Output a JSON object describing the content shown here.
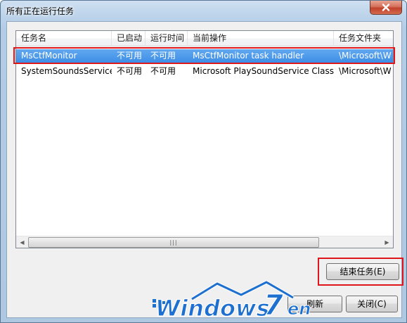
{
  "window": {
    "title": "所有正在运行任务",
    "close_icon": "close-icon"
  },
  "list": {
    "columns": [
      "任务名",
      "已启动",
      "运行时间",
      "当前操作",
      "任务文件夹"
    ],
    "rows": [
      {
        "name": "MsCtfMonitor",
        "started": "不可用",
        "runtime": "不可用",
        "action": "MsCtfMonitor task handler",
        "folder": "\\Microsoft\\W",
        "selected": true
      },
      {
        "name": "SystemSoundsService",
        "started": "不可用",
        "runtime": "不可用",
        "action": "Microsoft PlaySoundService Class",
        "folder": "\\Microsoft\\W",
        "selected": false
      }
    ],
    "scrollbar_grip": "|||"
  },
  "buttons": {
    "end_task": "结束任务(E)",
    "refresh_partial": "刷新",
    "close": "关闭(C)"
  },
  "watermark": {
    "brand": "Windows",
    "seven": "7",
    "suffix": "en"
  },
  "colors": {
    "selection": "#3b8de6",
    "highlight": "#e0171a",
    "watermark_blue": "#1d6fd0"
  }
}
